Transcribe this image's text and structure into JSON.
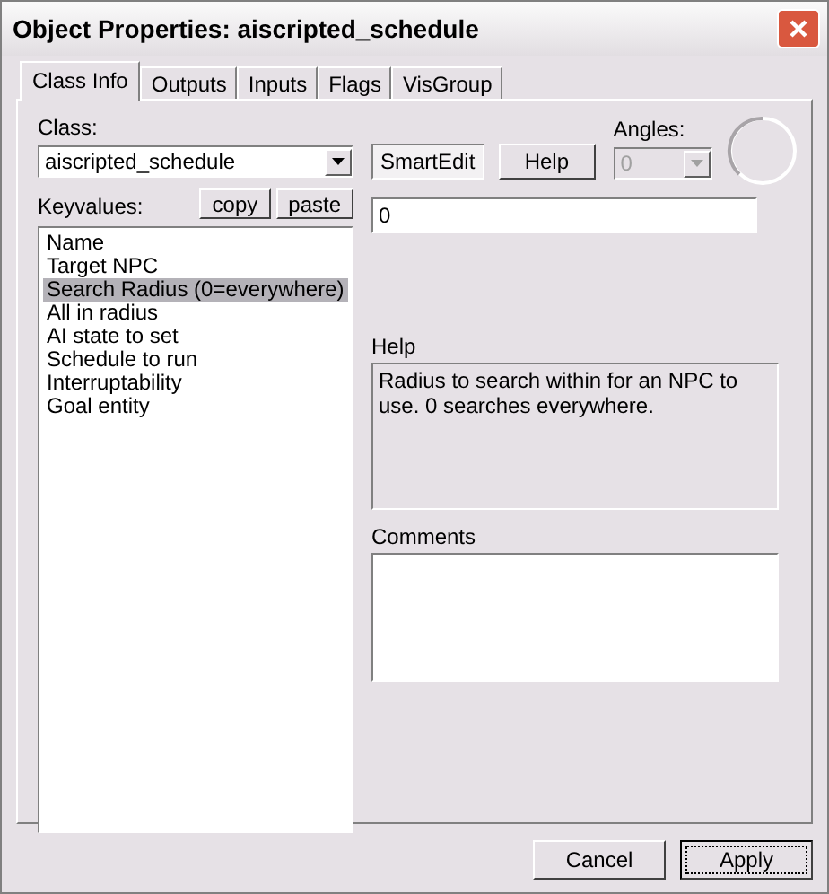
{
  "window": {
    "title": "Object Properties: aiscripted_schedule"
  },
  "tabs": [
    {
      "label": "Class Info",
      "selected": true
    },
    {
      "label": "Outputs",
      "selected": false
    },
    {
      "label": "Inputs",
      "selected": false
    },
    {
      "label": "Flags",
      "selected": false
    },
    {
      "label": "VisGroup",
      "selected": false
    }
  ],
  "class": {
    "label": "Class:",
    "value": "aiscripted_schedule"
  },
  "smartedit": {
    "label": "SmartEdit",
    "on": false
  },
  "help_button": "Help",
  "angles": {
    "label": "Angles:",
    "value": "0",
    "disabled": true
  },
  "keyvalues": {
    "label": "Keyvalues:",
    "copy": "copy",
    "paste": "paste",
    "items": [
      {
        "label": "Name",
        "selected": false
      },
      {
        "label": "Target NPC",
        "selected": false
      },
      {
        "label": "Search Radius (0=everywhere)",
        "selected": true
      },
      {
        "label": "All in radius",
        "selected": false
      },
      {
        "label": "AI state to set",
        "selected": false
      },
      {
        "label": "Schedule to run",
        "selected": false
      },
      {
        "label": "Interruptability",
        "selected": false
      },
      {
        "label": "Goal entity",
        "selected": false
      }
    ]
  },
  "value": "0",
  "help": {
    "label": "Help",
    "text": "Radius to search within for an NPC to use. 0 searches everywhere."
  },
  "comments": {
    "label": "Comments"
  },
  "buttons": [
    {
      "label": "Cancel",
      "default": false
    },
    {
      "label": "Apply",
      "default": true
    }
  ]
}
